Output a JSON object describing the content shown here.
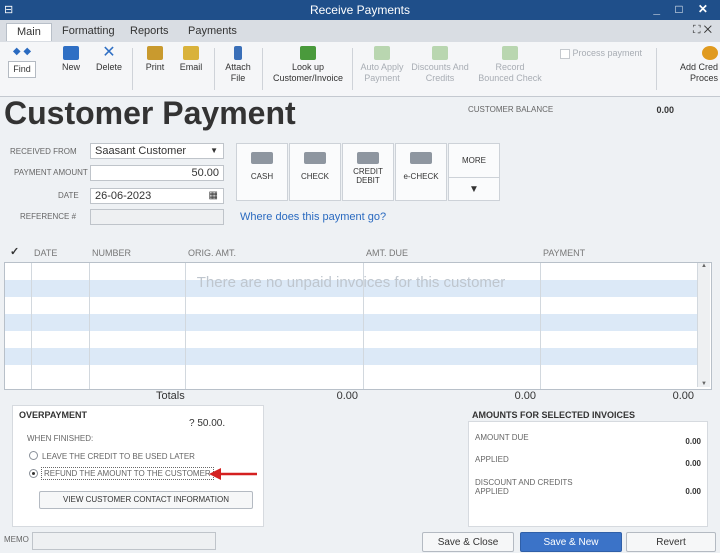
{
  "window": {
    "title": "Receive Payments",
    "system_icon": "⊟",
    "controls": "_ □ ✕"
  },
  "tabs": [
    "Main",
    "Formatting",
    "Reports",
    "Payments"
  ],
  "tab_right": "⛶ ✕",
  "toolbar": {
    "find": "Find",
    "new": "New",
    "delete": "Delete",
    "print": "Print",
    "email": "Email",
    "attach_1": "Attach",
    "attach_2": "File",
    "lookup_1": "Look up",
    "lookup_2": "Customer/Invoice",
    "autoapply_1": "Auto Apply",
    "autoapply_2": "Payment",
    "discounts_1": "Discounts And",
    "discounts_2": "Credits",
    "record_1": "Record",
    "record_2": "Bounced Check",
    "process_payment": "Process payment",
    "addcredit_1": "Add Cred",
    "addcredit_2": "Proces"
  },
  "heading": "Customer Payment",
  "customer_balance": {
    "label": "CUSTOMER BALANCE",
    "value": "0.00"
  },
  "form": {
    "received_from_label": "RECEIVED FROM",
    "received_from_value": "Saasant Customer",
    "payment_amount_label": "PAYMENT AMOUNT",
    "payment_amount_value": "50.00",
    "date_label": "DATE",
    "date_value": "26-06-2023",
    "reference_label": "REFERENCE #",
    "reference_value": ""
  },
  "pay_methods": {
    "cash": "CASH",
    "check": "CHECK",
    "credit_1": "CREDIT",
    "credit_2": "DEBIT",
    "echeck": "e-CHECK",
    "more": "MORE"
  },
  "where_link": "Where does this payment go?",
  "grid": {
    "columns": [
      "✓",
      "DATE",
      "NUMBER",
      "ORIG. AMT.",
      "AMT. DUE",
      "PAYMENT"
    ],
    "empty_message": "There are no unpaid invoices for this customer",
    "totals_label": "Totals",
    "totals": [
      "0.00",
      "0.00",
      "0.00"
    ]
  },
  "overpayment": {
    "title": "OVERPAYMENT",
    "amount": "? 50.00.",
    "when_finished": "WHEN FINISHED:",
    "option_leave": "LEAVE THE CREDIT TO BE USED LATER",
    "option_refund": "REFUND THE AMOUNT TO THE CUSTOMER",
    "view_contact": "VIEW CUSTOMER CONTACT INFORMATION"
  },
  "amounts": {
    "title": "AMOUNTS FOR SELECTED INVOICES",
    "amount_due_label": "AMOUNT DUE",
    "amount_due": "0.00",
    "applied_label": "APPLIED",
    "applied": "0.00",
    "discount_label_1": "DISCOUNT AND CREDITS",
    "discount_label_2": "APPLIED",
    "discount": "0.00"
  },
  "memo_label": "MEMO",
  "buttons": {
    "save_close": "Save & Close",
    "save_new": "Save & New",
    "revert": "Revert"
  },
  "colors": {
    "titlebar": "#1f4f8a",
    "accent_button": "#3b73c8",
    "alt_row": "#dce9f7",
    "arrow": "#d42020"
  }
}
